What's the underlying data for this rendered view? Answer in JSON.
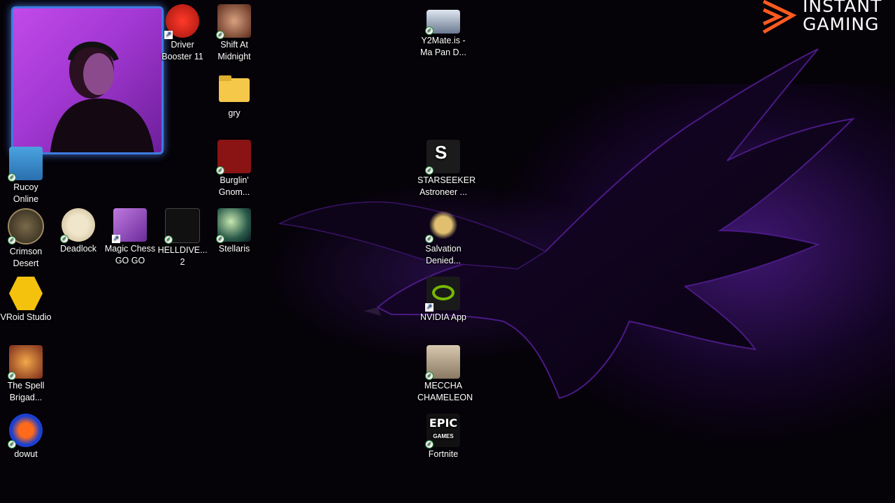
{
  "logo": {
    "line1": "INSTANT",
    "line2": "GAMING"
  },
  "icons": [
    {
      "id": "rucoy",
      "label": "Rucoy Online"
    },
    {
      "id": "crimson",
      "label": "Crimson Desert"
    },
    {
      "id": "deadlock",
      "label": "Deadlock"
    },
    {
      "id": "magic",
      "label": "Magic Chess GO GO"
    },
    {
      "id": "helldivers",
      "label": "HELLDIVE... 2"
    },
    {
      "id": "vroid",
      "label": "VRoid Studio"
    },
    {
      "id": "spell",
      "label": "The Spell Brigad..."
    },
    {
      "id": "dowut",
      "label": "dowut"
    },
    {
      "id": "driver",
      "label": "Driver Booster 11"
    },
    {
      "id": "shift",
      "label": "Shift At Midnight"
    },
    {
      "id": "gry",
      "label": "gry"
    },
    {
      "id": "burglin",
      "label": "Burglin' Gnom..."
    },
    {
      "id": "stellaris",
      "label": "Stellaris"
    },
    {
      "id": "y2mate",
      "label": "Y2Mate.is - Ma Pan D..."
    },
    {
      "id": "starseeker",
      "label": "STARSEEKER Astroneer ..."
    },
    {
      "id": "salvation",
      "label": "Salvation Denied..."
    },
    {
      "id": "nvidia",
      "label": "NVIDIA App"
    },
    {
      "id": "meccha",
      "label": "MECCHA CHAMELEON"
    },
    {
      "id": "fortnite",
      "label": "Fortnite"
    }
  ],
  "colors": {
    "accent_purple": "#7a2fd0",
    "nvidia_green": "#76b900",
    "webcam_border": "#3f7be0"
  }
}
